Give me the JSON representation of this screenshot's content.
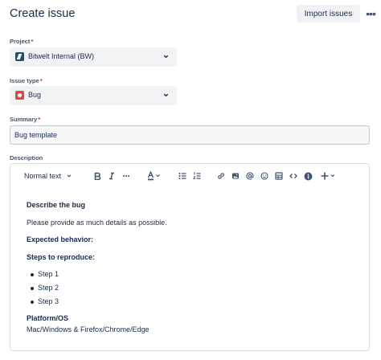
{
  "header": {
    "title": "Create issue",
    "import_label": "Import issues",
    "more_label": "•••"
  },
  "project": {
    "label": "Project",
    "required": "*",
    "value": "Bitwelt Internal (BW)",
    "icon": "project-avatar-icon"
  },
  "issue_type": {
    "label": "Issue type",
    "required": "*",
    "value": "Bug",
    "icon": "bug-icon"
  },
  "summary": {
    "label": "Summary",
    "required": "*",
    "value": "Bug template"
  },
  "description": {
    "label": "Description",
    "toolbar": {
      "text_style": "Normal text",
      "buttons": [
        "bold-icon",
        "italic-icon",
        "more-formatting-icon",
        "text-color-icon",
        "bullet-list-icon",
        "numbered-list-icon",
        "link-icon",
        "image-icon",
        "mention-icon",
        "emoji-icon",
        "table-icon",
        "code-icon",
        "info-icon",
        "insert-icon"
      ]
    },
    "content": {
      "h1": "Describe the bug",
      "p1": "Please provide as much details as possible.",
      "h2": "Expected behavior:",
      "h3": "Steps to reproduce:",
      "steps": [
        "Step 1",
        "Step 2",
        "Step 3"
      ],
      "h4": "Platform/OS",
      "p2": "Mac/Windows & Firefox/Chrome/Edge"
    }
  },
  "colors": {
    "text": "#172b4d",
    "subtle": "#44546f",
    "required": "#c9372c",
    "field_bg": "#f1f2f4",
    "bug": "#e2483d"
  }
}
